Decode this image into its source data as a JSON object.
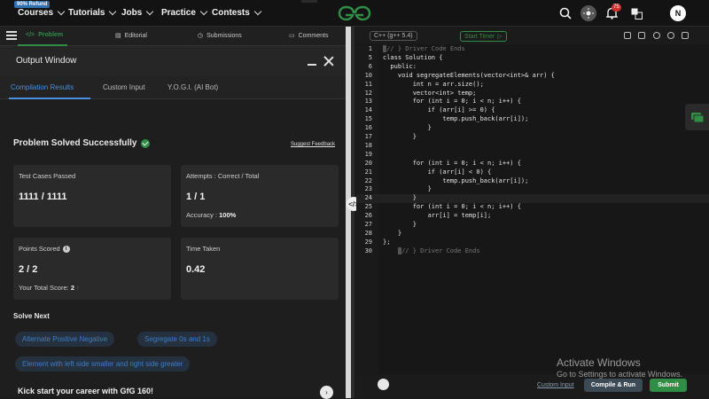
{
  "nav": {
    "refund_badge": "90% Refund",
    "items": [
      "Courses",
      "Tutorials",
      "Jobs",
      "Practice",
      "Contests"
    ],
    "notification_count": "75",
    "avatar_letter": "N",
    "icons": [
      "search-icon",
      "theme-toggle-icon",
      "bell-icon",
      "translate-icon"
    ],
    "brand_color": "#2f8d46"
  },
  "problem_tabs": {
    "items": [
      {
        "label": "Problem",
        "icon": "code-icon"
      },
      {
        "label": "Editorial",
        "icon": "book-icon"
      },
      {
        "label": "Submissions",
        "icon": "clock-icon"
      },
      {
        "label": "Comments",
        "icon": "chat-icon"
      }
    ],
    "active": "Problem"
  },
  "output_window": {
    "title": "Output Window",
    "tabs": [
      "Compilation Results",
      "Custom Input",
      "Y.O.G.I. (AI Bot)"
    ],
    "active_tab": "Compilation Results",
    "status": "Problem Solved Successfully",
    "feedback_link": "Suggest Feedback",
    "cards": {
      "tests": {
        "label": "Test Cases Passed",
        "value": "1111 / 1111"
      },
      "attempts": {
        "label": "Attempts : Correct / Total",
        "value": "1 / 1",
        "sub_label": "Accuracy :",
        "sub_value": "100%"
      },
      "points": {
        "label": "Points Scored",
        "value": "2 / 2",
        "sub_label": "Your Total Score:",
        "sub_value": "2"
      },
      "time": {
        "label": "Time Taken",
        "value": "0.42"
      }
    },
    "solve_next_title": "Solve Next",
    "solve_next": [
      "Alternate Positive Negative",
      "Segregate 0s and 1s",
      "Element with left side smaller and right side greater"
    ],
    "promo": "Kick start your career with GfG 160!"
  },
  "editor": {
    "language": "C++ (g++ 5.4)",
    "timer_label": "Start Timer",
    "lines": [
      {
        "n": "1",
        "text": "// } Driver Code Ends",
        "kind": "fold"
      },
      {
        "n": "5",
        "text": "class Solution {"
      },
      {
        "n": "6",
        "text": "  public:"
      },
      {
        "n": "10",
        "text": "    void segregateElements(vector<int>& arr) {"
      },
      {
        "n": "11",
        "text": "        int n = arr.size();"
      },
      {
        "n": "12",
        "text": "        vector<int> temp;"
      },
      {
        "n": "13",
        "text": "        for (int i = 0; i < n; i++) {"
      },
      {
        "n": "14",
        "text": "            if (arr[i] >= 0) {"
      },
      {
        "n": "15",
        "text": "                temp.push_back(arr[i]);"
      },
      {
        "n": "16",
        "text": "            }"
      },
      {
        "n": "17",
        "text": "        }"
      },
      {
        "n": "18",
        "text": ""
      },
      {
        "n": "19",
        "text": ""
      },
      {
        "n": "20",
        "text": "        for (int i = 0; i < n; i++) {"
      },
      {
        "n": "21",
        "text": "            if (arr[i] < 0) {"
      },
      {
        "n": "22",
        "text": "                temp.push_back(arr[i]);"
      },
      {
        "n": "23",
        "text": "            }"
      },
      {
        "n": "24",
        "text": "        }",
        "kind": "cur"
      },
      {
        "n": "25",
        "text": "        for (int i = 0; i < n; i++) {"
      },
      {
        "n": "26",
        "text": "            arr[i] = temp[i];"
      },
      {
        "n": "27",
        "text": "        }"
      },
      {
        "n": "28",
        "text": "    }"
      },
      {
        "n": "29",
        "text": "};"
      },
      {
        "n": "30",
        "text": "    // } Driver Code Ends",
        "kind": "fold2"
      }
    ],
    "custom_input": "Custom Input",
    "compile_run": "Compile & Run",
    "submit": "Submit"
  },
  "watermark": {
    "line1": "Activate Windows",
    "line2": "Go to Settings to activate Windows."
  }
}
